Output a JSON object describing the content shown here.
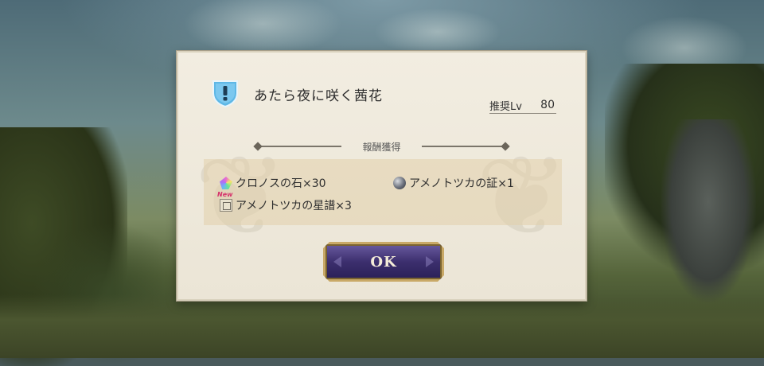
{
  "dialog": {
    "title": "あたら夜に咲く茜花",
    "recommended_label": "推奨Lv",
    "recommended_level": "80",
    "section_title": "報酬獲得",
    "rewards": [
      {
        "label": "クロノスの石×30",
        "icon": "chronos-stone-icon"
      },
      {
        "label": "アメノトツカの証×1",
        "icon": "orb-icon"
      },
      {
        "label": "アメノトツカの星譜×3",
        "icon": "score-book-icon",
        "badge": "New"
      }
    ],
    "ok_label": "OK"
  },
  "colors": {
    "dialog_bg": "#efe9dc",
    "reward_box": "#e2d0ac",
    "button_border": "#c9a967",
    "button_fill": "#3c2f6e",
    "shield": "#5fb8e6"
  }
}
